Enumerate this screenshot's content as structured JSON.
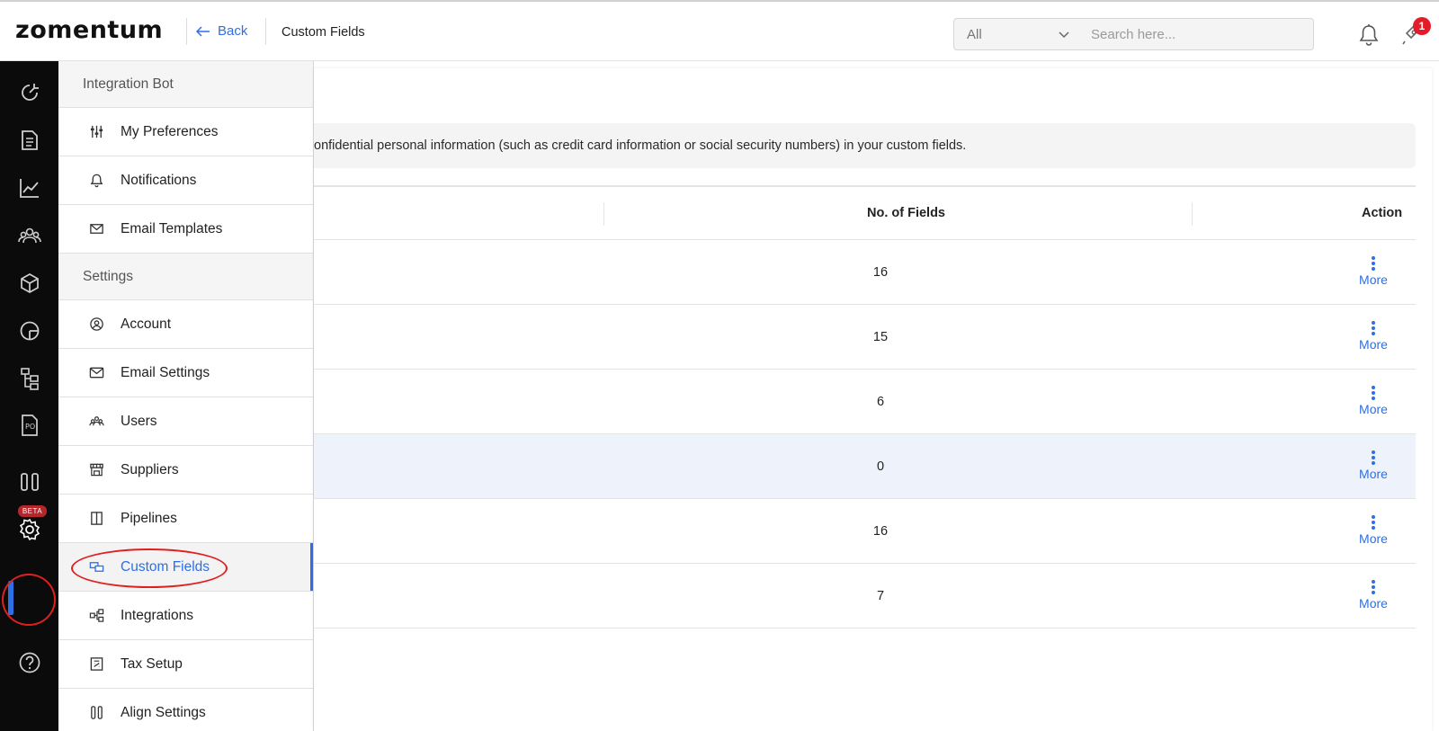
{
  "header": {
    "logo": "zomentum",
    "back_label": "Back",
    "page_title": "Custom Fields",
    "filter_value": "All",
    "search_placeholder": "Search here...",
    "notification_count": "1"
  },
  "rail": {
    "items": [
      "dashboard-icon",
      "document-icon",
      "reports-icon",
      "clients-icon",
      "products-icon",
      "chart-pie-icon",
      "workflow-icon",
      "purchase-order-icon",
      "pipelines-icon",
      "settings-icon",
      "help-icon"
    ],
    "beta_label": "BETA"
  },
  "menu": {
    "section1": "Integration Bot",
    "items1": [
      {
        "label": "My Preferences",
        "icon": "sliders-icon"
      },
      {
        "label": "Notifications",
        "icon": "bell-icon"
      },
      {
        "label": "Email Templates",
        "icon": "mail-icon"
      }
    ],
    "section2": "Settings",
    "items2": [
      {
        "label": "Account",
        "icon": "user-circle-icon"
      },
      {
        "label": "Email Settings",
        "icon": "envelope-icon"
      },
      {
        "label": "Users",
        "icon": "users-icon"
      },
      {
        "label": "Suppliers",
        "icon": "store-icon"
      },
      {
        "label": "Pipelines",
        "icon": "columns-icon"
      },
      {
        "label": "Custom Fields",
        "icon": "custom-fields-icon"
      },
      {
        "label": "Integrations",
        "icon": "integrations-icon"
      },
      {
        "label": "Tax Setup",
        "icon": "tax-icon"
      },
      {
        "label": "Align Settings",
        "icon": "align-icon"
      }
    ]
  },
  "main": {
    "notice": "onfidential personal information (such as credit card information or social security numbers) in your custom fields.",
    "columns": {
      "fields": "No. of Fields",
      "action": "Action"
    },
    "rows": [
      {
        "count": "16",
        "action": "More"
      },
      {
        "count": "15",
        "action": "More"
      },
      {
        "count": "6",
        "action": "More"
      },
      {
        "count": "0",
        "action": "More"
      },
      {
        "count": "16",
        "action": "More"
      },
      {
        "count": "7",
        "action": "More"
      }
    ]
  },
  "colors": {
    "accent": "#2f6fe4",
    "rail": "#0b0b0b",
    "highlight": "#e02020",
    "badge": "#e41b2b"
  }
}
